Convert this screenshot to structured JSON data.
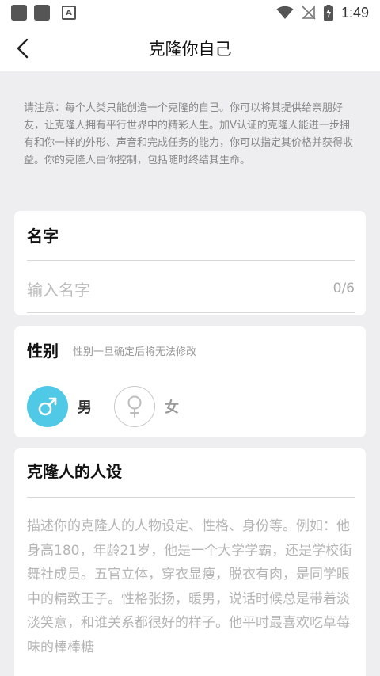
{
  "status_bar": {
    "time": "1:49",
    "a_icon_text": "A",
    "left_icons": [
      "app-square-icon",
      "app-square-icon",
      "accessibility-a-icon"
    ],
    "right_icons": [
      "wifi-icon",
      "no-signal-icon",
      "battery-charging-icon"
    ]
  },
  "header": {
    "title": "克隆你自己",
    "back_icon": "chevron-left-icon"
  },
  "notice": {
    "text": "请注意：每个人类只能创造一个克隆的自己。你可以将其提供给亲朋好友，让克隆人拥有平行世界中的精彩人生。加V认证的克隆人能进一步拥有和你一样的外形、声音和完成任务的能力，你可以指定其价格并获得收益。你的克隆人由你控制，包括随时终结其生命。"
  },
  "name_card": {
    "title": "名字",
    "placeholder": "输入名字",
    "value": "",
    "counter": "0/6"
  },
  "gender_card": {
    "title": "性别",
    "hint": "性别一旦确定后将无法修改",
    "options": [
      {
        "label": "男",
        "icon": "male-symbol-icon",
        "selected": true
      },
      {
        "label": "女",
        "icon": "female-symbol-icon",
        "selected": false
      }
    ]
  },
  "persona_card": {
    "title": "克隆人的人设",
    "placeholder": "描述你的克隆人的人物设定、性格、身份等。例如：他身高180，年龄21岁，他是一个大学学霸，还是学校街舞社成员。五官立体，穿衣显瘦，脱衣有肉，是同学眼中的精致王子。性格张扬，暖男，说话时候总是带着淡淡笑意，和谁关系都很好的样子。他平时最喜欢吃草莓味的棒棒糖"
  },
  "colors": {
    "accent": "#4fc9e6",
    "background": "#eeeef0",
    "card": "#ffffff"
  }
}
